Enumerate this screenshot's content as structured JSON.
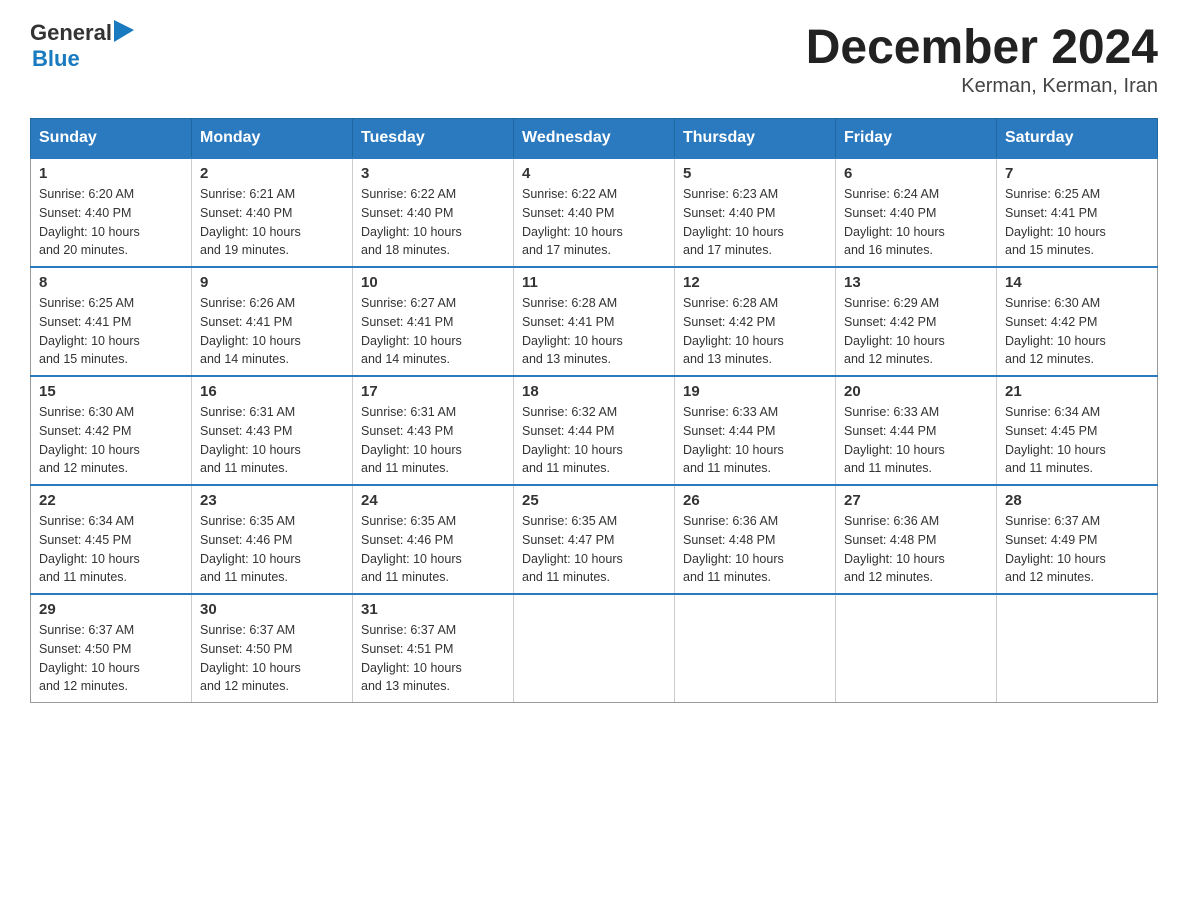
{
  "logo": {
    "general": "General",
    "triangle": "▶",
    "blue": "Blue"
  },
  "title": "December 2024",
  "subtitle": "Kerman, Kerman, Iran",
  "weekdays": [
    "Sunday",
    "Monday",
    "Tuesday",
    "Wednesday",
    "Thursday",
    "Friday",
    "Saturday"
  ],
  "weeks": [
    [
      {
        "day": "1",
        "sunrise": "6:20 AM",
        "sunset": "4:40 PM",
        "daylight": "10 hours and 20 minutes."
      },
      {
        "day": "2",
        "sunrise": "6:21 AM",
        "sunset": "4:40 PM",
        "daylight": "10 hours and 19 minutes."
      },
      {
        "day": "3",
        "sunrise": "6:22 AM",
        "sunset": "4:40 PM",
        "daylight": "10 hours and 18 minutes."
      },
      {
        "day": "4",
        "sunrise": "6:22 AM",
        "sunset": "4:40 PM",
        "daylight": "10 hours and 17 minutes."
      },
      {
        "day": "5",
        "sunrise": "6:23 AM",
        "sunset": "4:40 PM",
        "daylight": "10 hours and 17 minutes."
      },
      {
        "day": "6",
        "sunrise": "6:24 AM",
        "sunset": "4:40 PM",
        "daylight": "10 hours and 16 minutes."
      },
      {
        "day": "7",
        "sunrise": "6:25 AM",
        "sunset": "4:41 PM",
        "daylight": "10 hours and 15 minutes."
      }
    ],
    [
      {
        "day": "8",
        "sunrise": "6:25 AM",
        "sunset": "4:41 PM",
        "daylight": "10 hours and 15 minutes."
      },
      {
        "day": "9",
        "sunrise": "6:26 AM",
        "sunset": "4:41 PM",
        "daylight": "10 hours and 14 minutes."
      },
      {
        "day": "10",
        "sunrise": "6:27 AM",
        "sunset": "4:41 PM",
        "daylight": "10 hours and 14 minutes."
      },
      {
        "day": "11",
        "sunrise": "6:28 AM",
        "sunset": "4:41 PM",
        "daylight": "10 hours and 13 minutes."
      },
      {
        "day": "12",
        "sunrise": "6:28 AM",
        "sunset": "4:42 PM",
        "daylight": "10 hours and 13 minutes."
      },
      {
        "day": "13",
        "sunrise": "6:29 AM",
        "sunset": "4:42 PM",
        "daylight": "10 hours and 12 minutes."
      },
      {
        "day": "14",
        "sunrise": "6:30 AM",
        "sunset": "4:42 PM",
        "daylight": "10 hours and 12 minutes."
      }
    ],
    [
      {
        "day": "15",
        "sunrise": "6:30 AM",
        "sunset": "4:42 PM",
        "daylight": "10 hours and 12 minutes."
      },
      {
        "day": "16",
        "sunrise": "6:31 AM",
        "sunset": "4:43 PM",
        "daylight": "10 hours and 11 minutes."
      },
      {
        "day": "17",
        "sunrise": "6:31 AM",
        "sunset": "4:43 PM",
        "daylight": "10 hours and 11 minutes."
      },
      {
        "day": "18",
        "sunrise": "6:32 AM",
        "sunset": "4:44 PM",
        "daylight": "10 hours and 11 minutes."
      },
      {
        "day": "19",
        "sunrise": "6:33 AM",
        "sunset": "4:44 PM",
        "daylight": "10 hours and 11 minutes."
      },
      {
        "day": "20",
        "sunrise": "6:33 AM",
        "sunset": "4:44 PM",
        "daylight": "10 hours and 11 minutes."
      },
      {
        "day": "21",
        "sunrise": "6:34 AM",
        "sunset": "4:45 PM",
        "daylight": "10 hours and 11 minutes."
      }
    ],
    [
      {
        "day": "22",
        "sunrise": "6:34 AM",
        "sunset": "4:45 PM",
        "daylight": "10 hours and 11 minutes."
      },
      {
        "day": "23",
        "sunrise": "6:35 AM",
        "sunset": "4:46 PM",
        "daylight": "10 hours and 11 minutes."
      },
      {
        "day": "24",
        "sunrise": "6:35 AM",
        "sunset": "4:46 PM",
        "daylight": "10 hours and 11 minutes."
      },
      {
        "day": "25",
        "sunrise": "6:35 AM",
        "sunset": "4:47 PM",
        "daylight": "10 hours and 11 minutes."
      },
      {
        "day": "26",
        "sunrise": "6:36 AM",
        "sunset": "4:48 PM",
        "daylight": "10 hours and 11 minutes."
      },
      {
        "day": "27",
        "sunrise": "6:36 AM",
        "sunset": "4:48 PM",
        "daylight": "10 hours and 12 minutes."
      },
      {
        "day": "28",
        "sunrise": "6:37 AM",
        "sunset": "4:49 PM",
        "daylight": "10 hours and 12 minutes."
      }
    ],
    [
      {
        "day": "29",
        "sunrise": "6:37 AM",
        "sunset": "4:50 PM",
        "daylight": "10 hours and 12 minutes."
      },
      {
        "day": "30",
        "sunrise": "6:37 AM",
        "sunset": "4:50 PM",
        "daylight": "10 hours and 12 minutes."
      },
      {
        "day": "31",
        "sunrise": "6:37 AM",
        "sunset": "4:51 PM",
        "daylight": "10 hours and 13 minutes."
      },
      null,
      null,
      null,
      null
    ]
  ],
  "labels": {
    "sunrise": "Sunrise:",
    "sunset": "Sunset:",
    "daylight": "Daylight:"
  }
}
